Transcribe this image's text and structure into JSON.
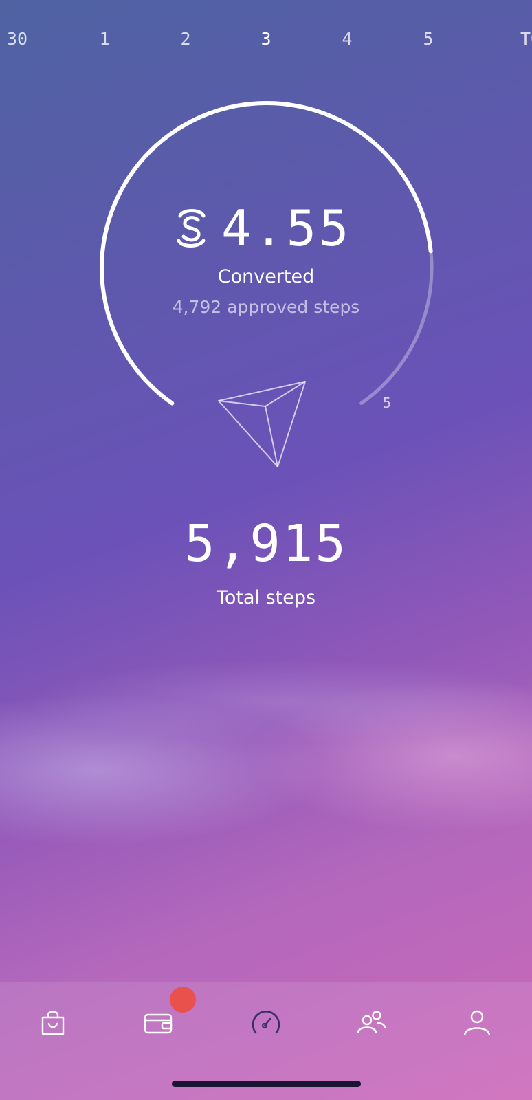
{
  "date_strip": {
    "items": [
      {
        "label": "30",
        "active": false
      },
      {
        "label": "1",
        "active": false
      },
      {
        "label": "2",
        "active": false
      },
      {
        "label": "3",
        "active": true
      },
      {
        "label": "4",
        "active": false
      },
      {
        "label": "5",
        "active": false
      },
      {
        "label": "TOD",
        "active": false
      }
    ]
  },
  "summary": {
    "currency_icon": "sweatcoin-icon",
    "amount": "4.55",
    "converted_label": "Converted",
    "approved_steps": "4,792 approved steps",
    "gauge_progress": 0.79,
    "gauge_max": "5",
    "center_icon": "paper-plane-icon"
  },
  "steps": {
    "total": "5,915",
    "label": "Total steps"
  },
  "tab_bar": {
    "tabs": [
      {
        "name": "shop-tab",
        "icon": "shopping-bag-icon"
      },
      {
        "name": "wallet-tab",
        "icon": "wallet-icon",
        "has_badge": true
      },
      {
        "name": "speedometer-tab",
        "icon": "speedometer-icon"
      },
      {
        "name": "friends-tab",
        "icon": "friends-icon"
      },
      {
        "name": "profile-tab",
        "icon": "profile-icon"
      }
    ]
  },
  "colors": {
    "badge": "#e8514c",
    "accent_white": "#ffffff"
  }
}
